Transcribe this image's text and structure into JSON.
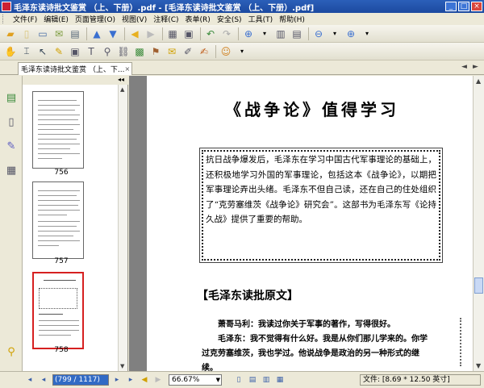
{
  "window": {
    "title": "毛泽东读诗批文鉴赏 （上、下册）.pdf - [毛泽东读诗批文鉴赏 （上、下册）.pdf]",
    "controls": [
      "_",
      "□",
      "×"
    ]
  },
  "menu": [
    "文件(F)",
    "编辑(E)",
    "页面管理(O)",
    "视图(V)",
    "注释(C)",
    "表单(R)",
    "安全(S)",
    "工具(T)",
    "帮助(H)"
  ],
  "tab": {
    "label": "毛泽东读诗批文鉴赏 （上、下...",
    "close": "×"
  },
  "tab_scroll": {
    "left": "◄",
    "right": "►"
  },
  "panel": {
    "title": "页面",
    "collapse": "◂◂"
  },
  "thumbnails": [
    {
      "label": "756",
      "selected": false
    },
    {
      "label": "757",
      "selected": false
    },
    {
      "label": "758",
      "selected": true
    }
  ],
  "page": {
    "title": "《战争论》值得学习",
    "intro": "抗日战争爆发后，毛泽东在学习中国古代军事理论的基础上，还积极地学习外国的军事理论，包括这本《战争论》，以期把军事理论弄出头绪。毛泽东不但自己读，还在自己的住处组织了“克劳塞维茨《战争论》研究会”。这部书为毛泽东写《论持久战》提供了重要的帮助。",
    "section_heading": "【毛泽东读批原文】",
    "paragraphs": [
      "萧哥马利：我读过你关于军事的著作，写得很好。",
      "毛泽东：我不觉得有什么好。我是从你们那儿学来的。你学过克劳塞维茨，我也学过。他说战争是政治的另一种形式的继续。"
    ]
  },
  "status": {
    "page_field": "(799 / 1117)",
    "zoom": "66.67%",
    "doc_size": "文件: [8.69 * 12.50 英寸]",
    "nav_first": "◂",
    "nav_prev": "◂",
    "nav_next": "▸",
    "nav_last": "▸"
  },
  "colors": {
    "titlebar": "#1c4aa0",
    "selection": "#d62020",
    "viewer_bg": "#808080"
  }
}
